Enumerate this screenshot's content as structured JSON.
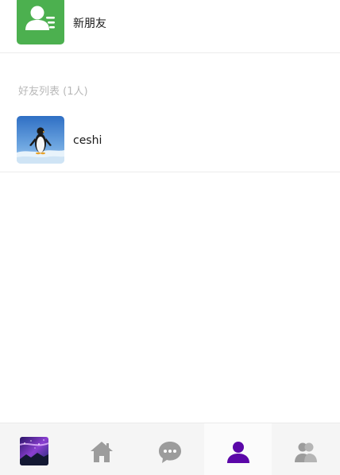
{
  "new_friends": {
    "label": "新朋友",
    "icon": "add-contact-icon",
    "icon_color": "#4cb04f"
  },
  "friend_list": {
    "title": "好友列表 (1人)",
    "items": [
      {
        "name": "ceshi",
        "avatar": "penguin-avatar"
      }
    ]
  },
  "tabbar": {
    "tabs": [
      {
        "name": "profile-avatar",
        "active": false
      },
      {
        "name": "home-icon",
        "active": false
      },
      {
        "name": "chat-bubble-icon",
        "active": false
      },
      {
        "name": "contact-icon",
        "active": true
      },
      {
        "name": "group-icon",
        "active": false
      }
    ],
    "active_color": "#5b07a8",
    "inactive_color": "#9c9c9c"
  }
}
